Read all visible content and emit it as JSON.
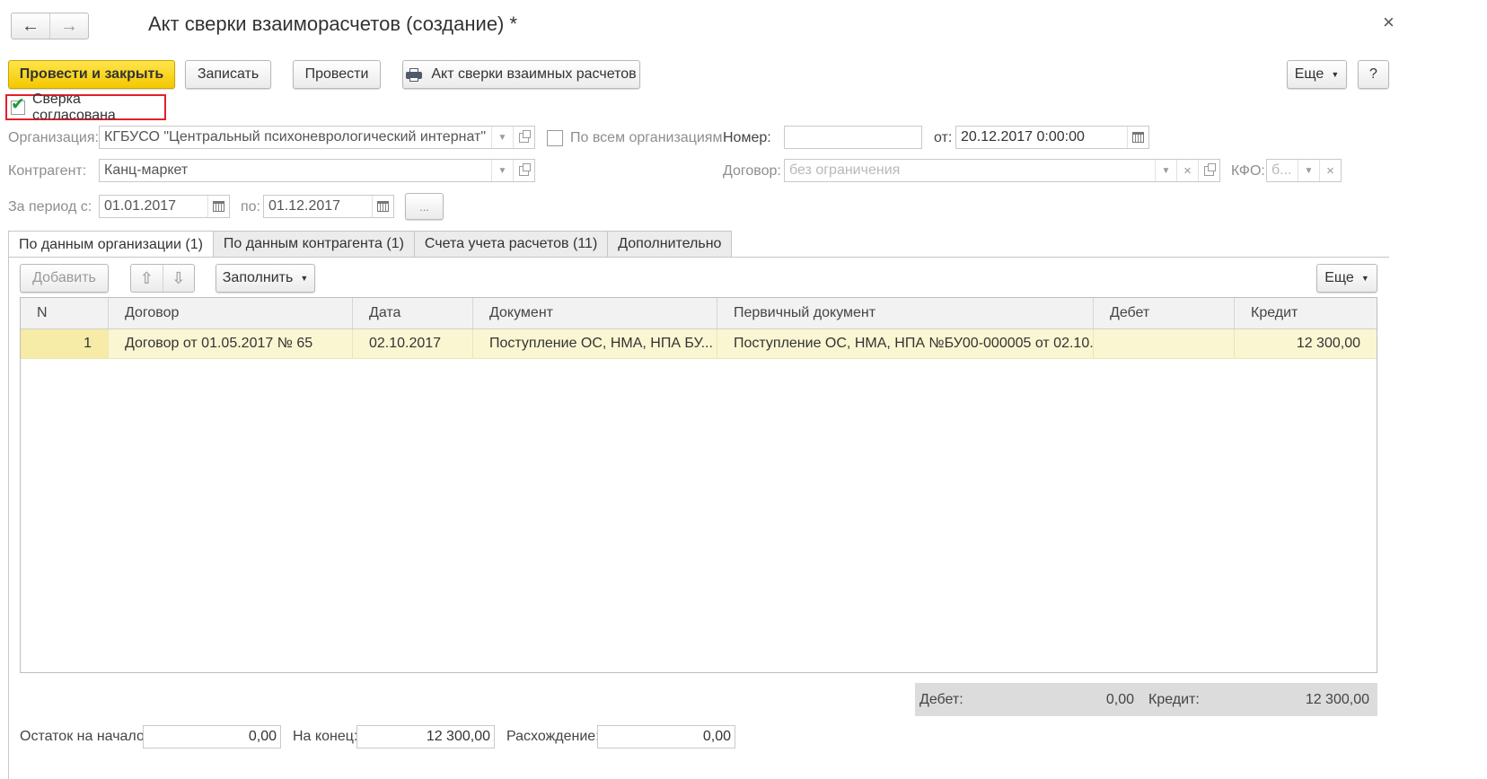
{
  "window": {
    "title": "Акт сверки взаиморасчетов (создание) *",
    "back_icon": "arrow-left-icon",
    "forward_icon": "arrow-right-icon",
    "close_icon": "close-icon",
    "close_glyph": "×"
  },
  "toolbar": {
    "post_close": "Провести и закрыть",
    "save": "Записать",
    "post": "Провести",
    "print_report": "Акт сверки взаимных расчетов",
    "more": "Еще",
    "help": "?"
  },
  "agreed": {
    "label": "Сверка согласована",
    "checked": true,
    "highlight_color": "#e3202a"
  },
  "form": {
    "org_label": "Организация:",
    "org_value": "КГБУСО \"Центральный психоневрологический интернат\"",
    "all_orgs_label": "По всем организациям",
    "number_label": "Номер:",
    "number_value": "",
    "date_label": "от:",
    "date_value": "20.12.2017  0:00:00",
    "counterparty_label": "Контрагент:",
    "counterparty_value": "Канц-маркет",
    "contract_label": "Договор:",
    "contract_placeholder": "без ограничения",
    "kfo_label": "КФО:",
    "kfo_value": "б...",
    "period_from_label": "За период с:",
    "period_from_value": "01.01.2017",
    "period_to_label": "по:",
    "period_to_value": "01.12.2017",
    "period_more": "..."
  },
  "tabs": [
    {
      "label": "По данным организации (1)",
      "active": true
    },
    {
      "label": "По данным контрагента (1)",
      "active": false
    },
    {
      "label": "Счета учета расчетов (11)",
      "active": false
    },
    {
      "label": "Дополнительно",
      "active": false
    }
  ],
  "table_toolbar": {
    "add": "Добавить",
    "up_icon": "arrow-up-icon",
    "down_icon": "arrow-down-icon",
    "fill": "Заполнить",
    "more": "Еще"
  },
  "table": {
    "columns": [
      "N",
      "Договор",
      "Дата",
      "Документ",
      "Первичный документ",
      "Дебет",
      "Кредит"
    ],
    "rows": [
      {
        "n": "1",
        "contract": "Договор от 01.05.2017 № 65",
        "date": "02.10.2017",
        "document": "Поступление ОС, НМА, НПА БУ...",
        "primary": "Поступление ОС, НМА, НПА №БУ00-000005 от 02.10...",
        "debit": "",
        "credit": "12 300,00"
      }
    ],
    "selected_row_color": "#fbf6d2"
  },
  "totals": {
    "debit_label": "Дебет:",
    "debit_value": "0,00",
    "credit_label": "Кредит:",
    "credit_value": "12 300,00"
  },
  "balance": {
    "start_label": "Остаток на начало:",
    "start_value": "0,00",
    "end_label": "На конец:",
    "end_value": "12 300,00",
    "diff_label": "Расхождение:",
    "diff_value": "0,00"
  },
  "colors": {
    "primary_button": "#f4c800",
    "accent_red": "#e3202a"
  }
}
